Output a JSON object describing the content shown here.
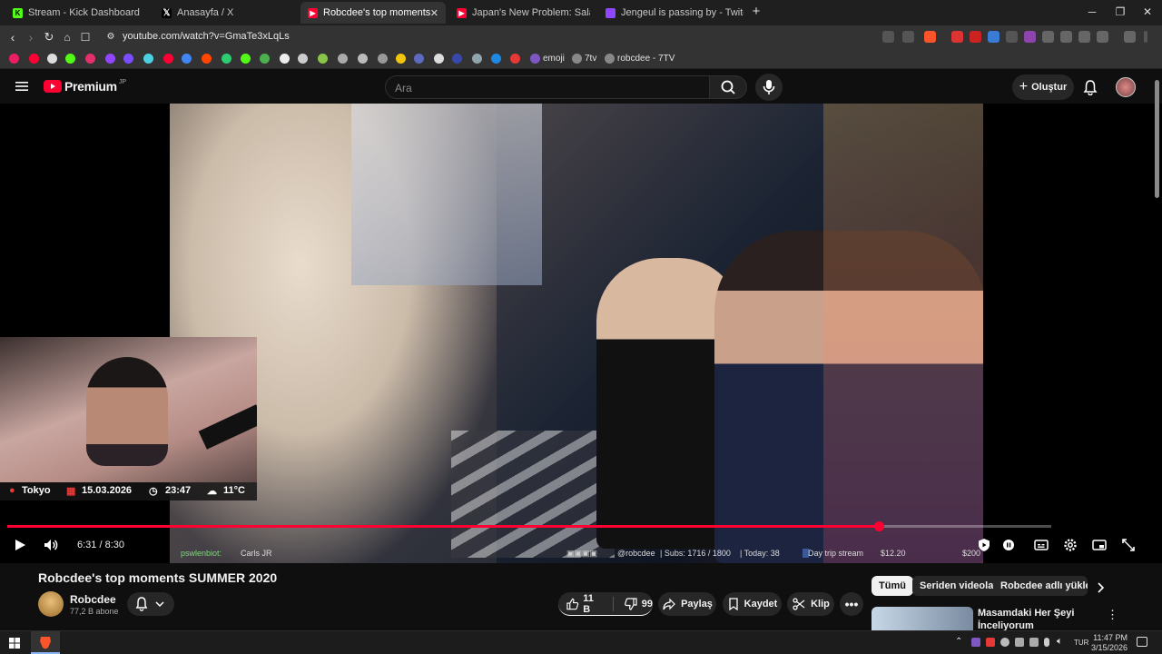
{
  "browser": {
    "tabs": [
      {
        "title": "Stream - Kick Dashboard",
        "favicon_color": "#53fc18",
        "favicon_letter": "K",
        "active": false
      },
      {
        "title": "Anasayfa / X",
        "favicon_color": "#1f1f1f",
        "favicon_letter": "X",
        "active": false
      },
      {
        "title": "Robcdee's top moments SUMM",
        "favicon_color": "#ff0033",
        "favicon_letter": "",
        "active": true
      },
      {
        "title": "Japan's New Problem: Salaryman Gri",
        "favicon_color": "#ff0033",
        "favicon_letter": "",
        "active": false
      },
      {
        "title": "Jengeul is passing by - Twitch",
        "favicon_color": "#9146ff",
        "favicon_letter": "",
        "active": false
      }
    ],
    "new_tab_label": "+",
    "url": "youtube.com/watch?v=GmaTe3xLqLs",
    "bookmarks": [
      "emoji",
      "7tv",
      "robcdee - 7TV"
    ]
  },
  "youtube": {
    "logo_text": "Premium",
    "logo_region": "JP",
    "search_placeholder": "Ara",
    "create_label": "Oluştur"
  },
  "player": {
    "webcam_info": {
      "location": "Tokyo",
      "date": "15.03.2026",
      "time": "23:47",
      "temperature": "11°C"
    },
    "current_time": "6:31",
    "duration": "8:30",
    "time_display": "6:31 / 8:30",
    "progress_fraction": 0.835,
    "overlay": {
      "chat_user": "pswlenbiot:",
      "chat_message": "Carls JR",
      "handle": "@robcdee",
      "subs": "| Subs: 1716 / 1800",
      "today": "| Today: 38",
      "goal": "Day trip stream",
      "amount1": "$12.20",
      "amount2": "$200"
    },
    "accent_color": "#ff0033"
  },
  "video": {
    "title": "Robcdee's top moments SUMMER 2020",
    "channel_name": "Robcdee",
    "subscribers": "77,2 B abone",
    "likes": "11 B",
    "dislikes": "99",
    "share_label": "Paylaş",
    "save_label": "Kaydet",
    "clip_label": "Klip"
  },
  "sidebar": {
    "chips": [
      "Tümü",
      "Seriden videolar",
      "Robcdee adlı yükleyic"
    ],
    "recommendation_title": "Masamdaki Her Şeyi İnceliyorum"
  },
  "taskbar": {
    "language": "TUR",
    "time": "11:47 PM",
    "date": "3/15/2026"
  }
}
